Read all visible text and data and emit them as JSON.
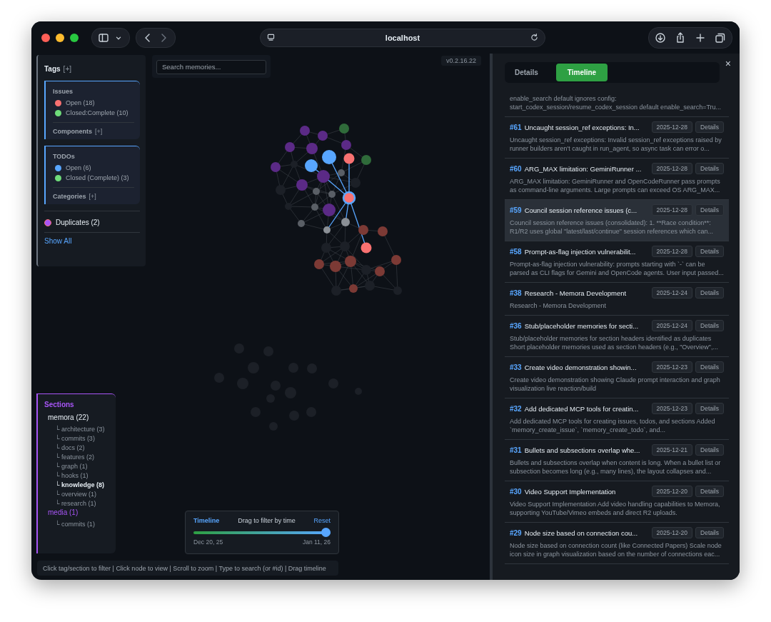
{
  "browser": {
    "url": "localhost"
  },
  "tags_panel": {
    "title": "Tags",
    "add": "[+]",
    "groups": [
      {
        "title": "Issues",
        "items": [
          {
            "label": "Open (18)",
            "color": "#f87171"
          },
          {
            "label": "Closed:Complete (10)",
            "color": "#6fdc7a"
          }
        ],
        "footer": "Components",
        "footer_add": "[+]"
      },
      {
        "title": "TODOs",
        "items": [
          {
            "label": "Open (6)",
            "color": "#58a6ff"
          },
          {
            "label": "Closed (Complete) (3)",
            "color": "#6fdc7a"
          }
        ],
        "footer": "Categories",
        "footer_add": "[+]"
      }
    ],
    "duplicates": {
      "label": "Duplicates (2)",
      "color": "#a855f7"
    },
    "show_all": "Show All"
  },
  "search": {
    "placeholder": "Search memories..."
  },
  "version": "v0.2.16.22",
  "sections": {
    "title": "Sections",
    "groups": [
      {
        "label": "memora (22)",
        "selected": true,
        "children": [
          {
            "label": "└ architecture (3)",
            "selected": false
          },
          {
            "label": "└ commits (3)",
            "selected": false
          },
          {
            "label": "└ docs (2)",
            "selected": false
          },
          {
            "label": "└ features (2)",
            "selected": false
          },
          {
            "label": "└ graph (1)",
            "selected": false
          },
          {
            "label": "└ hooks (1)",
            "selected": false
          },
          {
            "label": "└ knowledge (8)",
            "selected": true
          },
          {
            "label": "└ overview (1)",
            "selected": false
          },
          {
            "label": "└ research (1)",
            "selected": false
          }
        ]
      },
      {
        "label": "media (1)",
        "selected": false,
        "children": [
          {
            "label": "└ commits (1)",
            "selected": false
          }
        ]
      }
    ]
  },
  "timeline": {
    "title": "Timeline",
    "hint": "Drag to filter by time",
    "reset": "Reset",
    "level": 1,
    "start": "Dec 20, 25",
    "end": "Jan 11, 26"
  },
  "status_bar": "Click tag/section to filter | Click node to view | Scroll to zoom | Type to search (or #id) | Drag timeline",
  "panel": {
    "tabs": [
      {
        "label": "Details",
        "selected": false
      },
      {
        "label": "Timeline",
        "selected": true
      }
    ],
    "close": "×",
    "entries": [
      {
        "description": "enable_search default ignores config: start_codex_session/resume_codex_session default enable_search=Tru...",
        "selected": false
      },
      {
        "id": "#61",
        "title": "Uncaught session_ref exceptions: In...",
        "date": "2025-12-28",
        "action": "Details",
        "description": "Uncaught session_ref exceptions: Invalid session_ref exceptions raised by runner builders aren't caught in run_agent, so async task can error o...",
        "selected": false
      },
      {
        "id": "#60",
        "title": "ARG_MAX limitation: GeminiRunner ...",
        "date": "2025-12-28",
        "action": "Details",
        "description": "ARG_MAX limitation: GeminiRunner and OpenCodeRunner pass prompts as command-line arguments. Large prompts can exceed OS ARG_MAX...",
        "selected": false
      },
      {
        "id": "#59",
        "title": "Council session reference issues (c...",
        "date": "2025-12-28",
        "action": "Details",
        "description": "Council session reference issues (consolidated): 1. **Race condition**: R1/R2 uses global \"latest/last/continue\" session references which can...",
        "selected": true
      },
      {
        "id": "#58",
        "title": "Prompt-as-flag injection vulnerabilit...",
        "date": "2025-12-28",
        "action": "Details",
        "description": "Prompt-as-flag injection vulnerability: prompts starting with `-` can be parsed as CLI flags for Gemini and OpenCode agents. User input passed...",
        "selected": false
      },
      {
        "id": "#38",
        "title": "Research - Memora Development",
        "date": "2025-12-24",
        "action": "Details",
        "description": "Research - Memora Development",
        "selected": false
      },
      {
        "id": "#36",
        "title": "Stub/placeholder memories for secti...",
        "date": "2025-12-24",
        "action": "Details",
        "description": "Stub/placeholder memories for section headers identified as duplicates Short placeholder memories used as section headers (e.g., \"Overview\",...",
        "selected": false
      },
      {
        "id": "#33",
        "title": "Create video demonstration showin...",
        "date": "2025-12-23",
        "action": "Details",
        "description": "Create video demonstration showing Claude prompt interaction and graph visualization live reaction/build",
        "selected": false
      },
      {
        "id": "#32",
        "title": "Add dedicated MCP tools for creatin...",
        "date": "2025-12-23",
        "action": "Details",
        "description": "Add dedicated MCP tools for creating issues, todos, and sections Added `memory_create_issue`, `memory_create_todo`, and...",
        "selected": false
      },
      {
        "id": "#31",
        "title": "Bullets and subsections overlap whe...",
        "date": "2025-12-21",
        "action": "Details",
        "description": "Bullets and subsections overlap when content is long. When a bullet list or subsection becomes long (e.g., many lines), the layout collapses and...",
        "selected": false
      },
      {
        "id": "#30",
        "title": "Video Support Implementation",
        "date": "2025-12-20",
        "action": "Details",
        "description": "Video Support Implementation Add video handling capabilities to Memora, supporting YouTube/Vimeo embeds and direct R2 uploads.",
        "selected": false
      },
      {
        "id": "#29",
        "title": "Node size based on connection cou...",
        "date": "2025-12-20",
        "action": "Details",
        "description": "Node size based on connection count (like Connected Papers) Scale node icon size in graph visualization based on the number of connections eac...",
        "selected": false
      }
    ]
  }
}
